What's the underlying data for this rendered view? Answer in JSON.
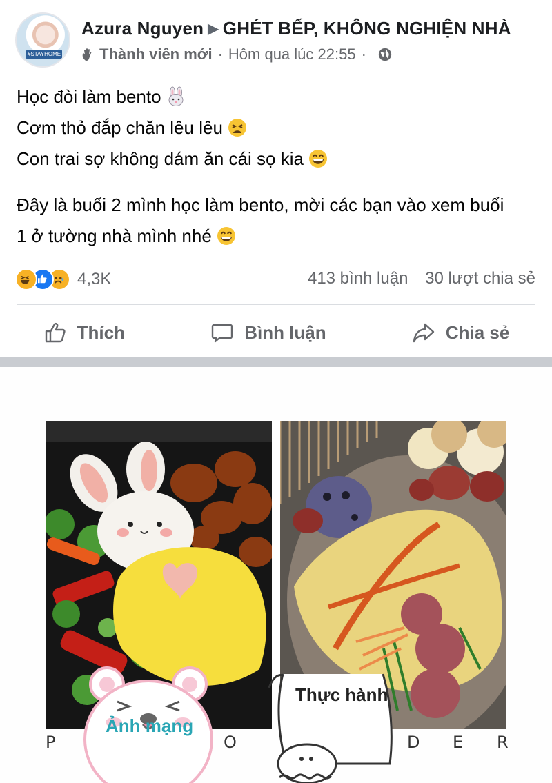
{
  "post": {
    "author": "Azura Nguyen",
    "group": "GHÉT BẾP, KHÔNG NGHIỆN NHÀ",
    "member_badge": "Thành viên mới",
    "timestamp": "Hôm qua lúc 22:55",
    "avatar_tag": "#STAYHOME",
    "text_lines": [
      "Học đòi làm bento",
      "Cơm thỏ đắp chăn  lêu lêu",
      "Con trai sợ không dám ăn cái sọ kia",
      "Đây là buổi 2 mình học làm bento, mời các bạn vào xem buổi",
      "1 ở tường nhà mình nhé"
    ]
  },
  "engagement": {
    "reaction_count": "4,3K",
    "comments": "413 bình luận",
    "shares": "30 lượt chia sẻ"
  },
  "actions": {
    "like": "Thích",
    "comment": "Bình luận",
    "share": "Chia sẻ"
  },
  "photo": {
    "left_caption": "Ảnh mạng",
    "right_caption": "Thực hành",
    "watermark_letters": [
      "P",
      "O",
      "D",
      "E",
      "R"
    ]
  },
  "colors": {
    "secondary_text": "#65676b",
    "like_blue": "#1877f2",
    "divider": "#dadde1"
  }
}
